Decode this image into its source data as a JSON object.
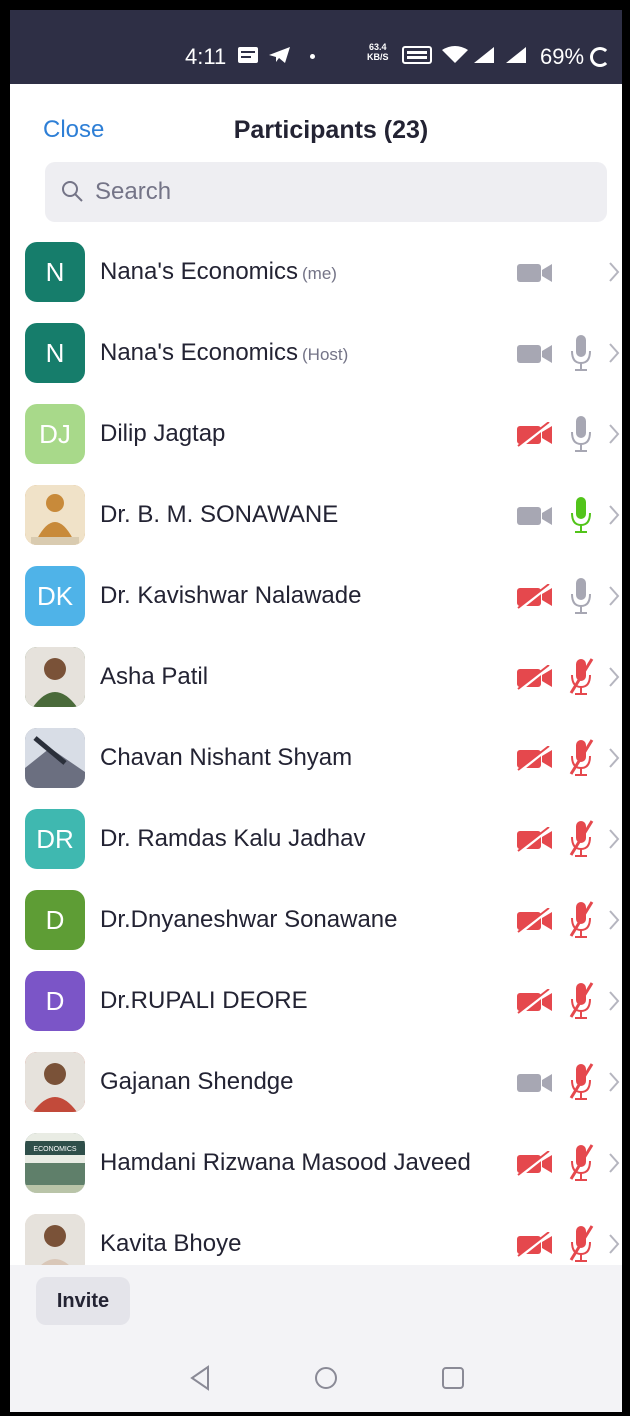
{
  "status_bar": {
    "time": "4:11",
    "speed_top": "63.4",
    "speed_bottom": "KB/S",
    "battery": "69%"
  },
  "header": {
    "close_label": "Close",
    "title": "Participants (23)"
  },
  "search": {
    "placeholder": "Search"
  },
  "colors": {
    "accent": "#2e7fd6",
    "muted_red": "#e5484d",
    "unmuted_green": "#52c41a",
    "icon_gray": "#a7a7b3"
  },
  "participants": [
    {
      "initials": "N",
      "name": "Nana's Economics",
      "tag": "(me)",
      "avatar_color": "#167d6b",
      "photo": "",
      "video": "on",
      "mic": "none"
    },
    {
      "initials": "N",
      "name": "Nana's Economics",
      "tag": "(Host)",
      "avatar_color": "#167d6b",
      "photo": "",
      "video": "on",
      "mic": "on"
    },
    {
      "initials": "DJ",
      "name": "Dilip Jagtap",
      "tag": "",
      "avatar_color": "#a8d98a",
      "photo": "",
      "video": "off",
      "mic": "on"
    },
    {
      "initials": "",
      "name": "Dr. B. M. SONAWANE",
      "tag": "",
      "avatar_color": "#c88a3a",
      "photo": "statue",
      "video": "on",
      "mic": "speaking"
    },
    {
      "initials": "DK",
      "name": "Dr. Kavishwar Nalawade",
      "tag": "",
      "avatar_color": "#4fb3e8",
      "photo": "",
      "video": "off",
      "mic": "on"
    },
    {
      "initials": "",
      "name": "Asha Patil",
      "tag": "",
      "avatar_color": "#4a6a3a",
      "photo": "person",
      "video": "off",
      "mic": "muted"
    },
    {
      "initials": "",
      "name": "Chavan Nishant Shyam",
      "tag": "",
      "avatar_color": "#6b6f80",
      "photo": "scene",
      "video": "off",
      "mic": "muted"
    },
    {
      "initials": "DR",
      "name": "Dr. Ramdas Kalu Jadhav",
      "tag": "",
      "avatar_color": "#3fb8b0",
      "photo": "",
      "video": "off",
      "mic": "muted"
    },
    {
      "initials": "D",
      "name": "Dr.Dnyaneshwar Sonawane",
      "tag": "",
      "avatar_color": "#5e9d35",
      "photo": "",
      "video": "off",
      "mic": "muted"
    },
    {
      "initials": "D",
      "name": "Dr.RUPALI DEORE",
      "tag": "",
      "avatar_color": "#7b55c7",
      "photo": "",
      "video": "off",
      "mic": "muted"
    },
    {
      "initials": "",
      "name": "Gajanan Shendge",
      "tag": "",
      "avatar_color": "#c24a3a",
      "photo": "person",
      "video": "on",
      "mic": "muted"
    },
    {
      "initials": "",
      "name": "Hamdani Rizwana Masood Javeed",
      "tag": "",
      "avatar_color": "#5f7f6a",
      "photo": "book",
      "video": "off",
      "mic": "muted"
    },
    {
      "initials": "",
      "name": "Kavita Bhoye",
      "tag": "",
      "avatar_color": "#d9c7b8",
      "photo": "person",
      "video": "off",
      "mic": "muted"
    }
  ],
  "avatar_book_text": "ECONOMICS",
  "footer": {
    "invite_label": "Invite"
  }
}
